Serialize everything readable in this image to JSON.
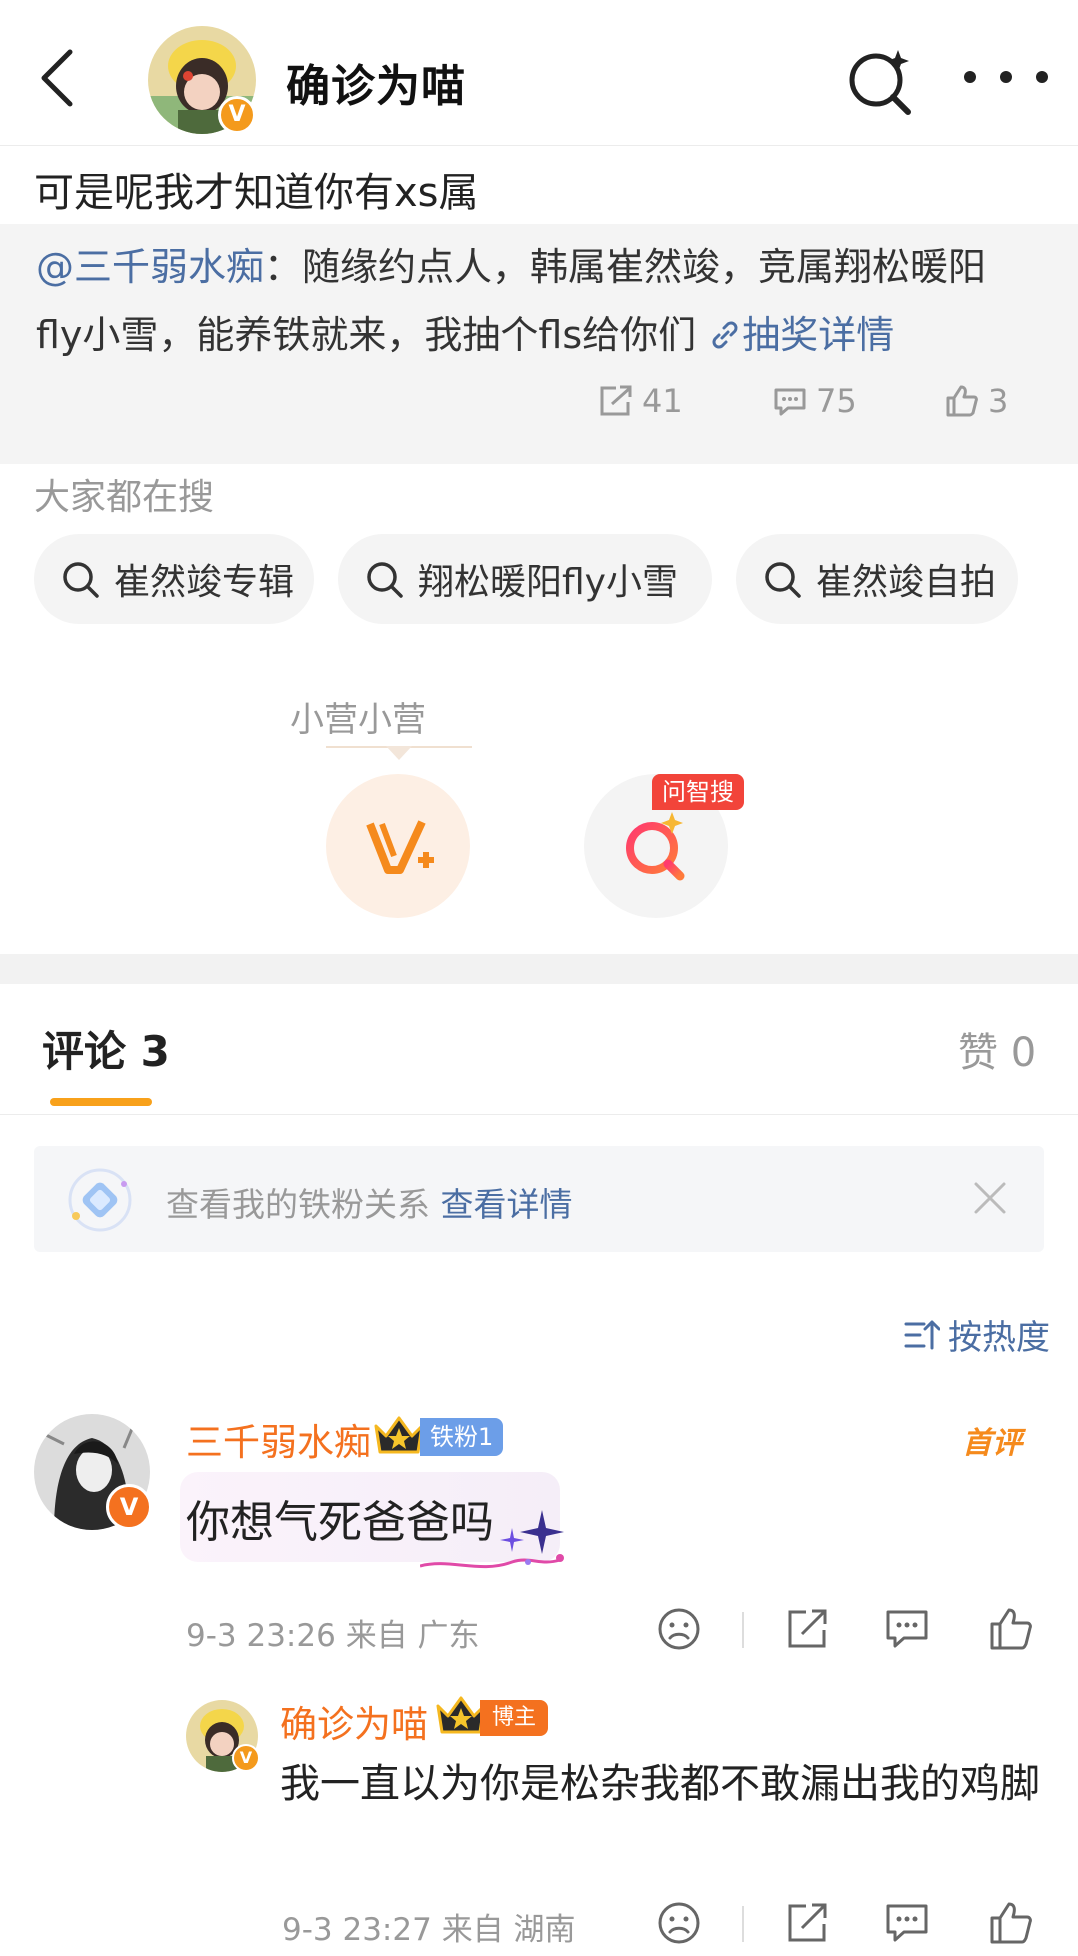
{
  "header": {
    "author_name": "确诊为喵",
    "icons": {
      "back": "back-arrow-icon",
      "search": "ai-search-icon",
      "more": "more-icon"
    },
    "verified_badge": "V"
  },
  "post": {
    "repost_text": "可是呢我才知道你有xs属",
    "quoted": {
      "at_user": "@三千弱水痴",
      "text_part1": "：随缘约点人，韩属崔然竣，竞属翔松暖阳",
      "text_part2": "fly小雪，能养铁就来，我抽个fls给你们",
      "link_label": "抽奖详情",
      "stats": {
        "reposts": "41",
        "comments": "75",
        "likes": "3"
      }
    }
  },
  "search_section": {
    "title": "大家都在搜",
    "chips": [
      "崔然竣专辑",
      "翔松暖阳fly小雪",
      "崔然竣自拍"
    ]
  },
  "assistant": {
    "tooltip": "小营小营",
    "ai_badge": "问智搜"
  },
  "tabs": {
    "comments_label": "评论 3",
    "likes_label": "赞 0"
  },
  "fan_banner": {
    "text": "查看我的铁粉关系",
    "link": "查看详情"
  },
  "sort": {
    "label": "按热度"
  },
  "comments": [
    {
      "name": "三千弱水痴",
      "badge": "铁粉1",
      "tag": "首评",
      "text": "你想气死爸爸吗",
      "time": "9-3 23:26",
      "location": "来自 广东",
      "verified": "V"
    }
  ],
  "replies": [
    {
      "name": "确诊为喵",
      "badge": "博主",
      "text": "我一直以为你是松杂我都不敢漏出我的鸡脚",
      "time": "9-3 23:27",
      "location": "来自 湖南",
      "verified": "V"
    }
  ],
  "colors": {
    "accent_orange": "#f4711f",
    "link_blue": "#4b6ea3",
    "tab_underline": "#f8a11b",
    "badge_red": "#f2443a"
  }
}
